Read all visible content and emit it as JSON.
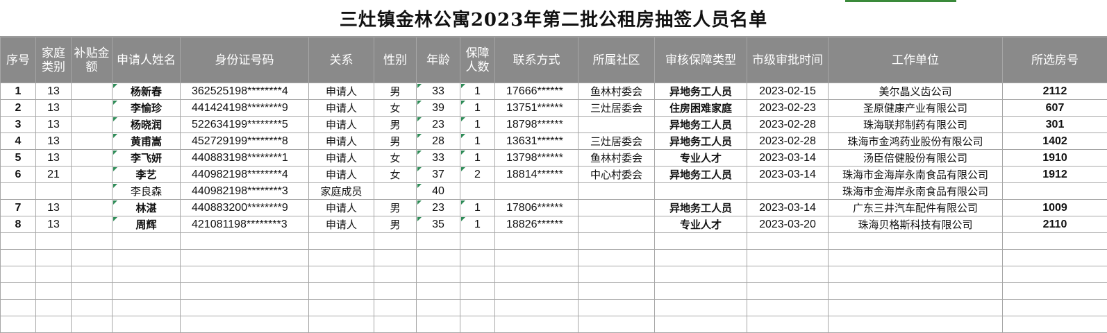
{
  "title": "三灶镇金林公寓2023年第二批公租房抽签人员名单",
  "headers": [
    "序号",
    "家庭类别",
    "补贴金额",
    "申请人姓名",
    "身份证号码",
    "关系",
    "性别",
    "年龄",
    "保障人数",
    "联系方式",
    "所属社区",
    "审核保障类型",
    "市级审批时间",
    "工作单位",
    "所选房号"
  ],
  "rows": [
    [
      "1",
      "13",
      "",
      "杨新春",
      "362525198********4",
      "申请人",
      "男",
      "33",
      "1",
      "17666******",
      "鱼林村委会",
      "异地务工人员",
      "2023-02-15",
      "美尔晶义齿公司",
      "2112"
    ],
    [
      "2",
      "13",
      "",
      "李愉珍",
      "441424198********9",
      "申请人",
      "女",
      "39",
      "1",
      "13751******",
      "三灶居委会",
      "住房困难家庭",
      "2023-02-23",
      "圣原健康产业有限公司",
      "607"
    ],
    [
      "3",
      "13",
      "",
      "杨晓润",
      "522634199********5",
      "申请人",
      "男",
      "23",
      "1",
      "18798******",
      "",
      "异地务工人员",
      "2023-02-28",
      "珠海联邦制药有限公司",
      "301"
    ],
    [
      "4",
      "13",
      "",
      "黄甫嵩",
      "452729199********8",
      "申请人",
      "男",
      "28",
      "1",
      "13631******",
      "三灶居委会",
      "异地务工人员",
      "2023-02-28",
      "珠海市金鸿药业股份有限公司",
      "1402"
    ],
    [
      "5",
      "13",
      "",
      "李飞妍",
      "440883198********1",
      "申请人",
      "女",
      "33",
      "1",
      "13798******",
      "鱼林村委会",
      "专业人才",
      "2023-03-14",
      "汤臣倍健股份有限公司",
      "1910"
    ],
    [
      "6",
      "21",
      "",
      "李艺",
      "440982198********4",
      "申请人",
      "女",
      "37",
      "2",
      "18814******",
      "中心村委会",
      "异地务工人员",
      "2023-03-14",
      "珠海市金海岸永南食品有限公司",
      "1912"
    ],
    [
      "",
      "",
      "",
      "李良森",
      "440982198********3",
      "家庭成员",
      "",
      "40",
      "",
      "",
      "",
      "",
      "",
      "珠海市金海岸永南食品有限公司",
      ""
    ],
    [
      "7",
      "13",
      "",
      "林湛",
      "440883200********9",
      "申请人",
      "男",
      "23",
      "1",
      "17806******",
      "",
      "异地务工人员",
      "2023-03-14",
      "广东三井汽车配件有限公司",
      "1009"
    ],
    [
      "8",
      "13",
      "",
      "周辉",
      "421081198********3",
      "申请人",
      "男",
      "35",
      "1",
      "18826******",
      "",
      "专业人才",
      "2023-03-20",
      "珠海贝格斯科技有限公司",
      "2110"
    ]
  ],
  "empty_rows": 6,
  "colors": {
    "header_bg": "#8a8a8a",
    "grid": "#a6a6a6",
    "accent": "#3a8a3a"
  }
}
